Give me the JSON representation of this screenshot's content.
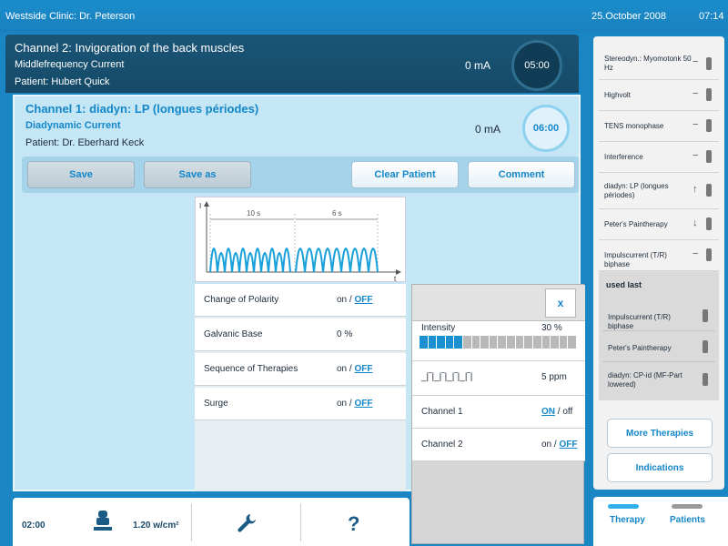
{
  "topbar": {
    "clinic": "Westside Clinic: Dr. Peterson",
    "date": "25.October 2008",
    "time": "07:14"
  },
  "channel2": {
    "title": "Channel 2: Invigoration of the back muscles",
    "current": "Middlefrequency Current",
    "patient": "Patient: Hubert Quick",
    "intensity": "0 mA",
    "timer": "05:00"
  },
  "channel1": {
    "title": "Channel 1: diadyn: LP (longues périodes)",
    "current": "Diadynamic Current",
    "patient": "Patient: Dr. Eberhard Keck",
    "intensity": "0 mA",
    "timer": "06:00"
  },
  "buttons": {
    "save": "Save",
    "save_as": "Save as",
    "clear_patient": "Clear Patient",
    "comment": "Comment"
  },
  "waveform": {
    "axis_i": "I",
    "axis_t": "t",
    "label_1": "10 s",
    "label_2": "6 s"
  },
  "settings": [
    {
      "label": "Change of Polarity",
      "on": "on",
      "sep": " / ",
      "off": "OFF"
    },
    {
      "label": "Galvanic Base",
      "value": "0 %"
    },
    {
      "label": "Sequence of Therapies",
      "on": "on",
      "sep": " / ",
      "off": "OFF"
    },
    {
      "label": "Surge",
      "on": "on",
      "sep": " / ",
      "off": "OFF"
    }
  ],
  "popup": {
    "close": "x",
    "intensity_label": "Intensity",
    "intensity_value": "30 %",
    "intensity_level": 0.3,
    "pattern_label": "_|‾|_|‾|_|‾|_|‾|",
    "pattern_value": "5 ppm",
    "ch1_label": "Channel 1",
    "ch1_on": "ON",
    "ch1_sep": " / ",
    "ch1_off": "off",
    "ch2_label": "Channel 2",
    "ch2_on": "on",
    "ch2_sep": " / ",
    "ch2_off": "OFF"
  },
  "sidebar": {
    "items": [
      {
        "label": "Stereodyn.: Myomotonk 50 Hz",
        "mark": "−"
      },
      {
        "label": "Highvolt",
        "mark": "−"
      },
      {
        "label": "TENS monophase",
        "mark": "−"
      },
      {
        "label": "Interference",
        "mark": "−"
      },
      {
        "label": "diadyn: LP (longues périodes)",
        "mark": "↑"
      },
      {
        "label": "Peter's Paintherapy",
        "mark": "↓"
      },
      {
        "label": "Impulscurrent (T/R) biphase",
        "mark": "−"
      }
    ],
    "used_last_title": "used last",
    "used_last": [
      {
        "label": "Impulscurrent (T/R) biphase"
      },
      {
        "label": "Peter's Paintherapy"
      },
      {
        "label": "diadyn: CP-id (MF-Part lowered)"
      }
    ],
    "more_therapies": "More Therapies",
    "indications": "Indications"
  },
  "bottom": {
    "time": "02:00",
    "area": "1.20 w/cm²",
    "help": "?"
  },
  "tabs": {
    "therapy": "Therapy",
    "patients": "Patients"
  },
  "colors": {
    "accent": "#1387c9",
    "header": "#1a86c4",
    "panel": "#c4e6f5"
  }
}
